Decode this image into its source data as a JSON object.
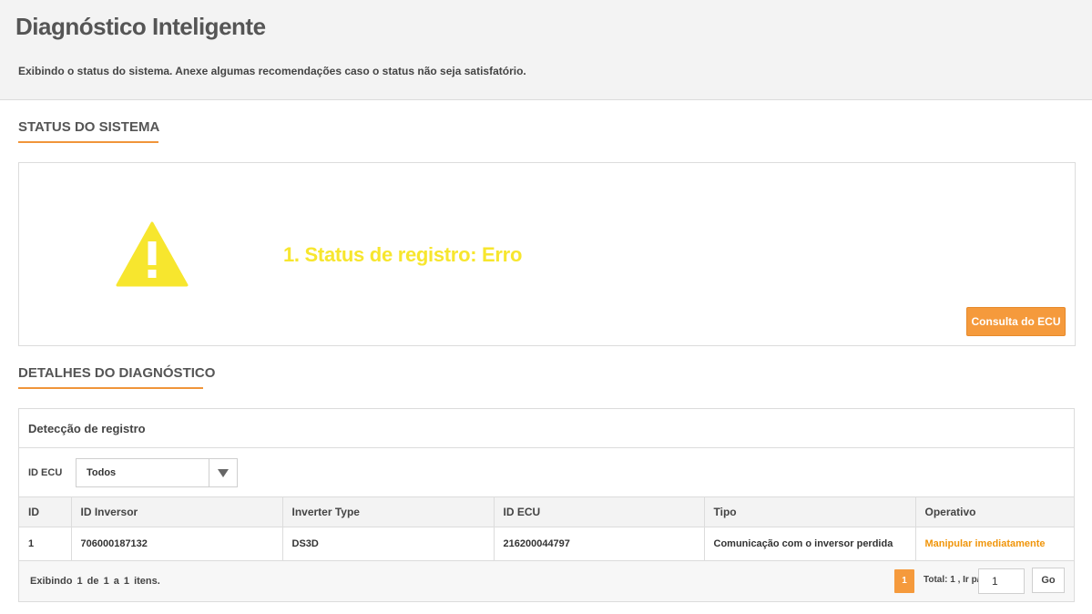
{
  "header": {
    "title": "Diagnóstico Inteligente",
    "subtitle": "Exibindo o status do sistema. Anexe algumas recomendações caso o status não seja satisfatório."
  },
  "status_section": {
    "title": "STATUS DO SISTEMA",
    "status_text": "1. Status de registro: Erro",
    "status_color": "#f7e62e",
    "icon": "warning-icon",
    "button_label": "Consulta do ECU"
  },
  "details_section": {
    "title": "DETALHES DO DIAGNÓSTICO",
    "panel_title": "Detecção de registro",
    "filter": {
      "label": "ID ECU",
      "selected": "Todos"
    },
    "columns": [
      "ID",
      "ID Inversor",
      "Inverter Type",
      "ID ECU",
      "Tipo",
      "Operativo"
    ],
    "rows": [
      {
        "id": "1",
        "inverter_id": "706000187132",
        "inverter_type": "DS3D",
        "ecu_id": "216200044797",
        "type": "Comunicação com o inversor perdida",
        "action": "Manipular imediatamente"
      }
    ],
    "pagination": {
      "info": "Exibindo 1 de 1 a 1 itens.",
      "current_page": "1",
      "total_label": "Total: 1 , Ir p/",
      "goto_value": "1",
      "go_label": "Go"
    }
  },
  "colors": {
    "accent": "#f59a3c",
    "link": "#f0950a"
  }
}
